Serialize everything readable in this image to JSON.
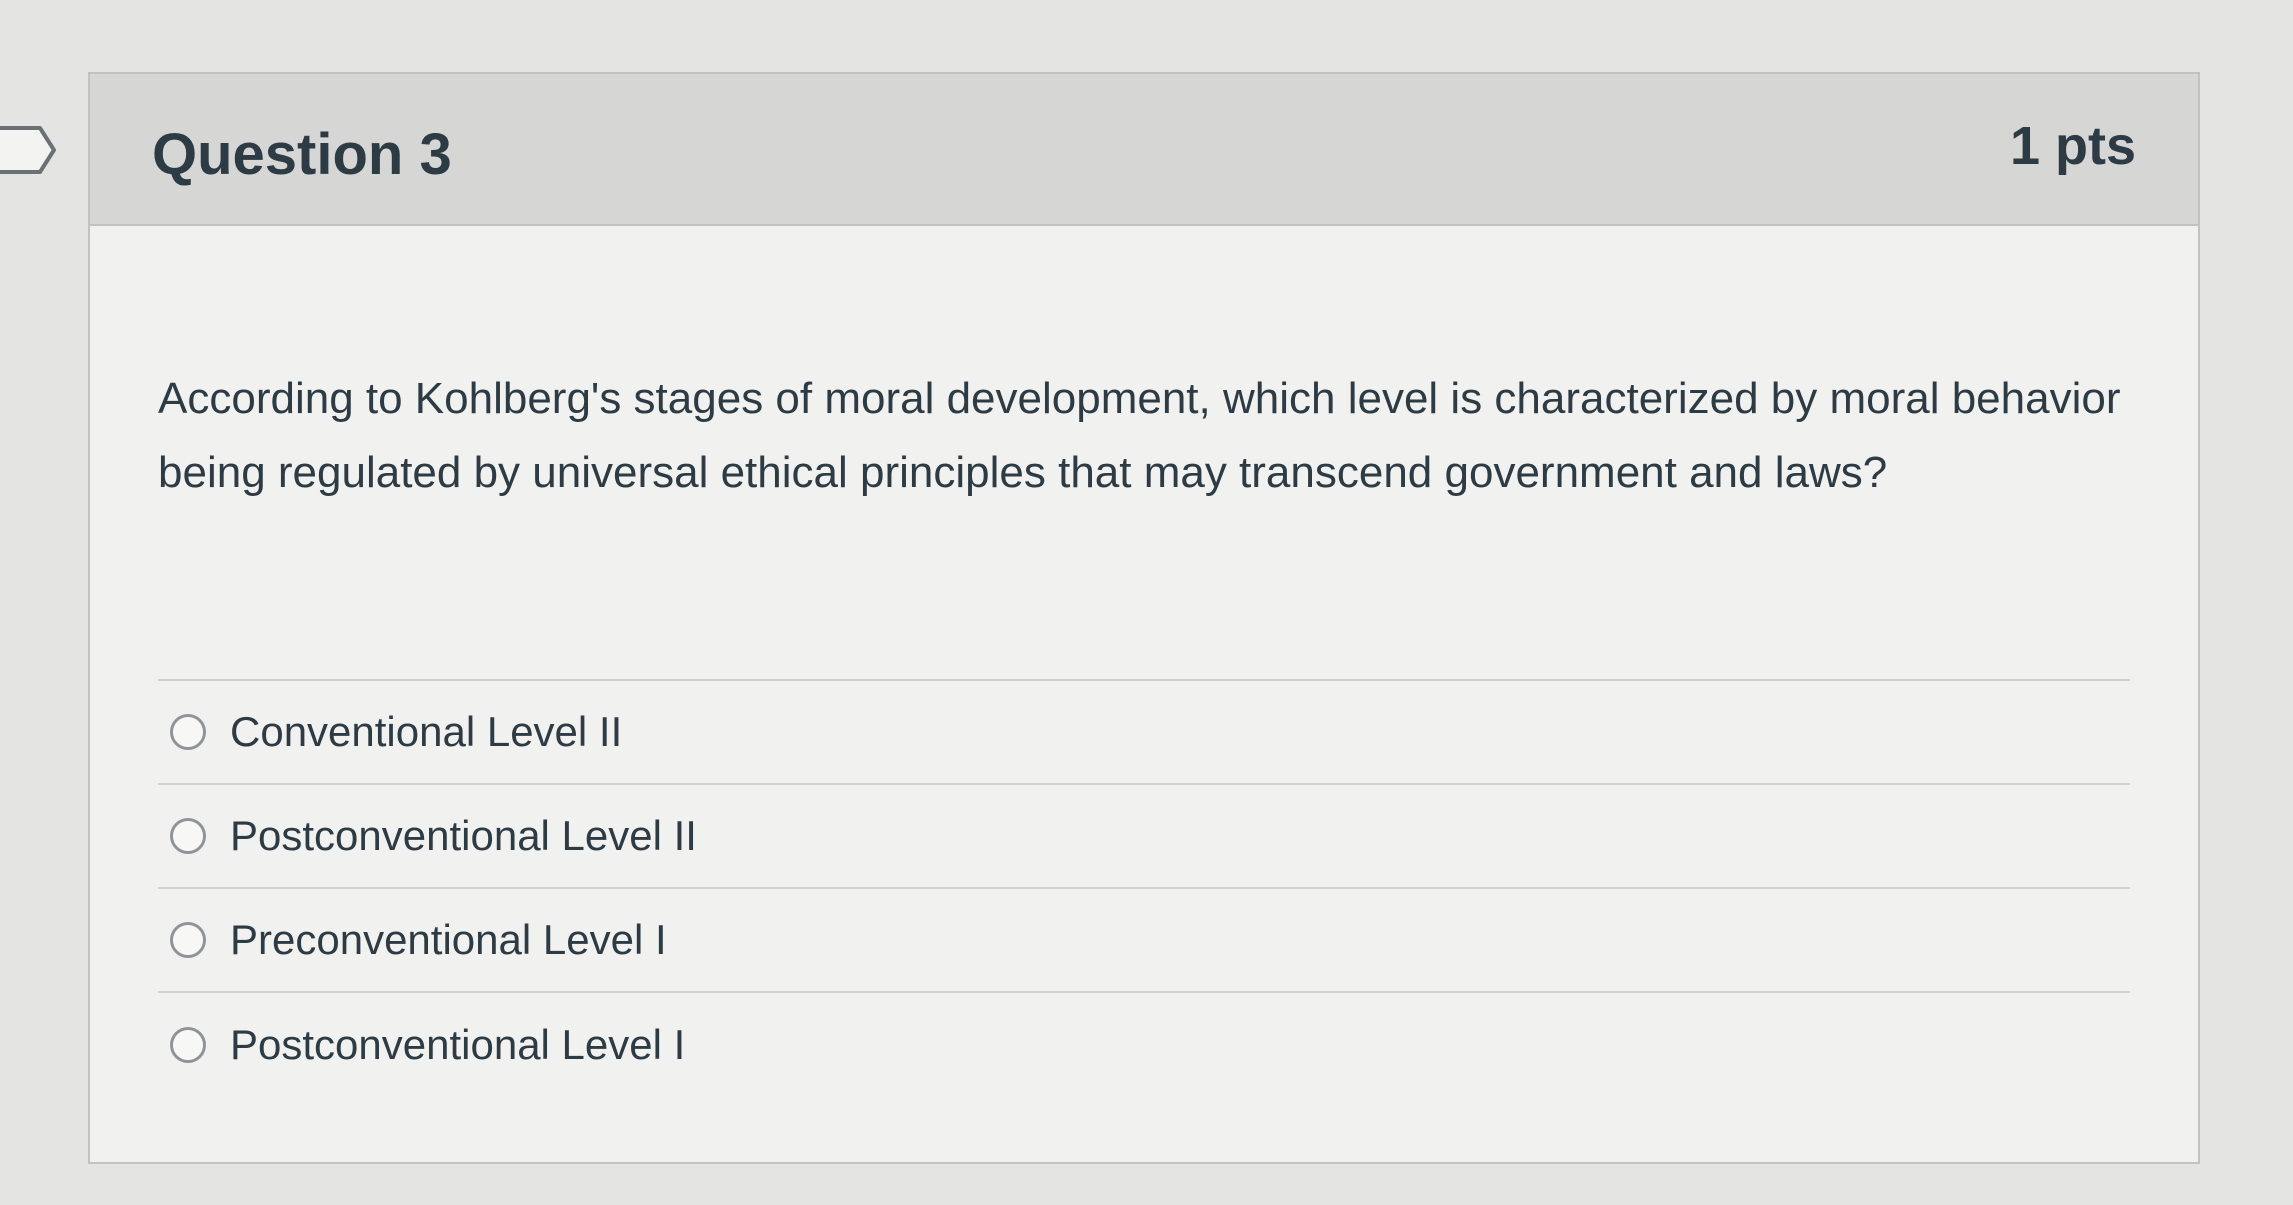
{
  "question": {
    "title": "Question 3",
    "points": "1 pts",
    "text": "According to Kohlberg's stages of moral development, which level is characterized by moral behavior being regulated by universal ethical principles that may transcend government and laws?",
    "answers": [
      {
        "label": "Conventional Level II",
        "selected": false
      },
      {
        "label": "Postconventional Level II",
        "selected": false
      },
      {
        "label": "Preconventional Level I",
        "selected": false
      },
      {
        "label": "Postconventional Level I",
        "selected": false
      }
    ]
  },
  "colors": {
    "background": "#e4e4e2",
    "header": "#d6d7d5",
    "card": "#f1f1ef",
    "text": "#2d3b45"
  }
}
